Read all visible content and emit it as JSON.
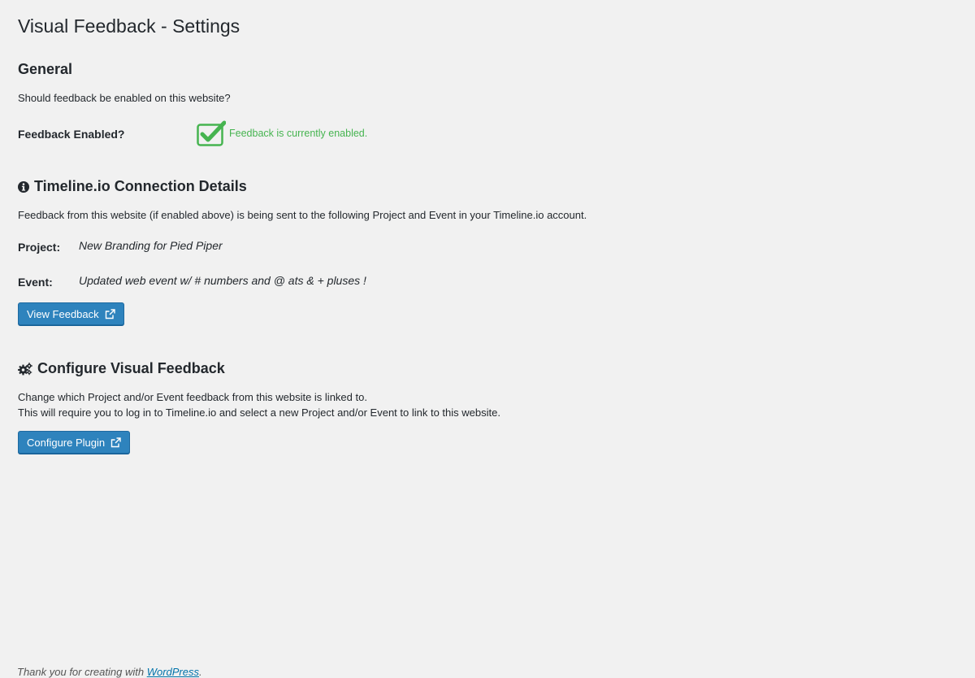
{
  "page": {
    "title": "Visual Feedback - Settings"
  },
  "general": {
    "heading": "General",
    "description": "Should feedback be enabled on this website?",
    "feedback_label": "Feedback Enabled?",
    "status_text": "Feedback is currently enabled.",
    "enabled": true
  },
  "connection": {
    "icon": "info-circle-icon",
    "heading": "Timeline.io Connection Details",
    "description": "Feedback from this website (if enabled above) is being sent to the following Project and Event in your Timeline.io account.",
    "project_label": "Project:",
    "project_value": "New Branding for Pied Piper",
    "event_label": "Event:",
    "event_value": "Updated web event w/ # numbers and @ ats & + pluses !",
    "button_label": "View Feedback"
  },
  "configure": {
    "icon": "gears-icon",
    "heading": "Configure Visual Feedback",
    "line1": "Change which Project and/or Event feedback from this website is linked to.",
    "line2": "This will require you to log in to Timeline.io and select a new Project and/or Event to link to this website.",
    "button_label": "Configure Plugin"
  },
  "footer": {
    "text": "Thank you for creating with ",
    "link": "WordPress",
    "end": "."
  },
  "colors": {
    "accent": "#2e83bd",
    "success": "#46b450",
    "text": "#23282d",
    "background": "#f1f1f1"
  }
}
